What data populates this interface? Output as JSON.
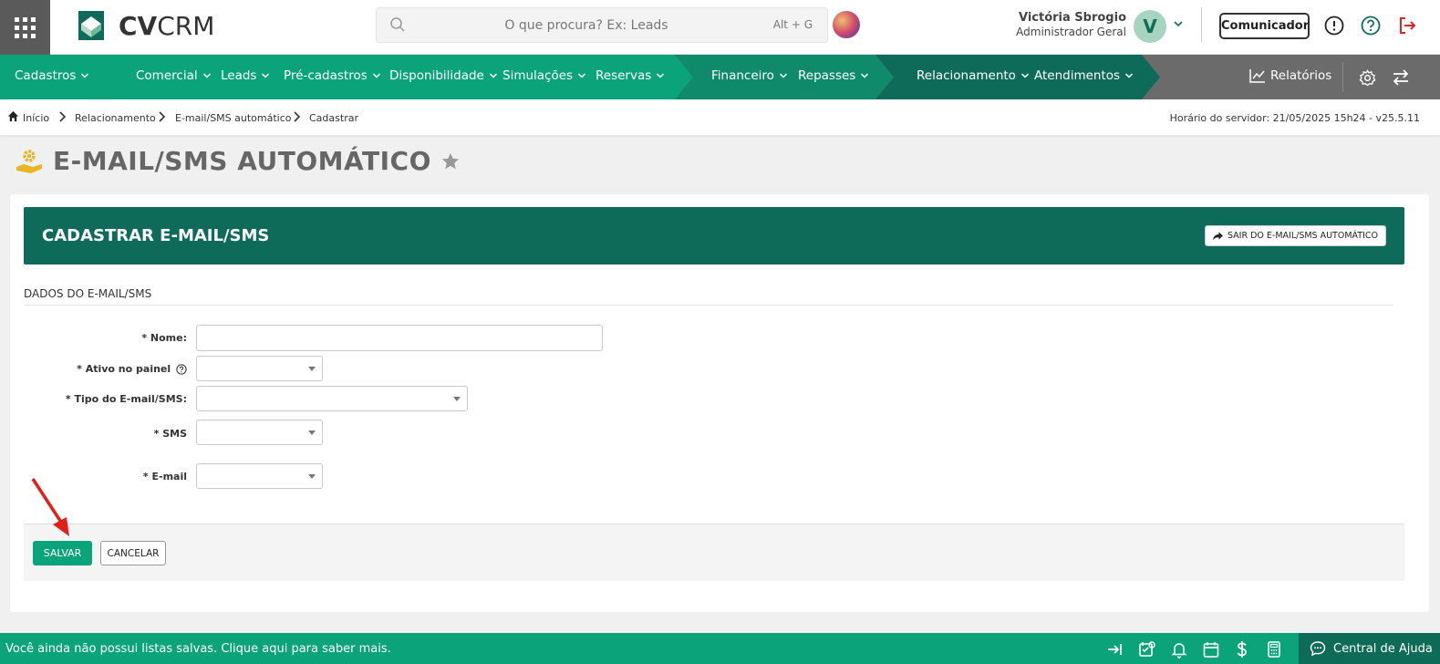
{
  "app": {
    "logo_bold": "CV",
    "logo_light": "CRM"
  },
  "search": {
    "placeholder": "O que procura? Ex: Leads",
    "shortcut": "Alt + G"
  },
  "user": {
    "name": "Victória Sbrogio",
    "role": "Administrador Geral",
    "initial": "V"
  },
  "header_buttons": {
    "comunicador": "Comunicador"
  },
  "nav": {
    "items": [
      {
        "label": "Cadastros"
      },
      {
        "label": "Comercial"
      },
      {
        "label": "Leads"
      },
      {
        "label": "Pré-cadastros"
      },
      {
        "label": "Disponibilidade"
      },
      {
        "label": "Simulações"
      },
      {
        "label": "Reservas"
      },
      {
        "label": "Financeiro"
      },
      {
        "label": "Repasses"
      },
      {
        "label": "Relacionamento"
      },
      {
        "label": "Atendimentos"
      }
    ],
    "reports": "Relatórios"
  },
  "breadcrumb": {
    "items": [
      "Início",
      "Relacionamento",
      "E-mail/SMS automático",
      "Cadastrar"
    ],
    "server_time": "Horário do servidor: 21/05/2025 15h24 - v25.5.11"
  },
  "page": {
    "title": "E-MAIL/SMS AUTOMÁTICO"
  },
  "panel": {
    "title": "CADASTRAR E-MAIL/SMS",
    "exit_button": "SAIR DO E-MAIL/SMS AUTOMÁTICO",
    "section_title": "DADOS DO E-MAIL/SMS",
    "fields": {
      "nome": {
        "label": "* Nome:",
        "value": ""
      },
      "ativo": {
        "label": "* Ativo no painel",
        "value": ""
      },
      "tipo": {
        "label": "* Tipo do E-mail/SMS:",
        "value": ""
      },
      "sms": {
        "label": "* SMS",
        "value": ""
      },
      "email": {
        "label": "* E-mail",
        "value": ""
      }
    },
    "save_button": "SALVAR",
    "cancel_button": "CANCELAR"
  },
  "statusbar": {
    "message": "Você ainda não possui listas salvas. Clique aqui para saber mais.",
    "help_center": "Central de Ajuda"
  },
  "colors": {
    "primary_green": "#0aa37a",
    "dark_green": "#0e6b5a",
    "nav_gray": "#6b6b6b",
    "arrow_red": "#e0201b"
  }
}
